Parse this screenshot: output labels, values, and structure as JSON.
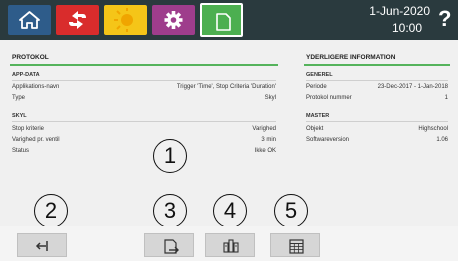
{
  "header": {
    "tabs": [
      {
        "name": "home",
        "icon": "home-icon",
        "color": "#2e5c8a"
      },
      {
        "name": "flush",
        "icon": "arrows-icon",
        "color": "#d92c2c"
      },
      {
        "name": "sun",
        "icon": "sun-icon",
        "color": "#f5c518"
      },
      {
        "name": "settings",
        "icon": "gear-icon",
        "color": "#9e3d8c"
      },
      {
        "name": "report",
        "icon": "document-icon",
        "color": "#4caf50",
        "active": true
      }
    ],
    "date": "1-Jun-2020",
    "time": "10:00",
    "help_label": "?"
  },
  "protokol": {
    "title": "PROTOKOL",
    "app_data": {
      "title": "APP-DATA",
      "rows": [
        {
          "label": "Applikations-navn",
          "value": "Trigger 'Time', Stop Criteria 'Duration'"
        },
        {
          "label": "Type",
          "value": "Skyl"
        }
      ]
    },
    "skyl": {
      "title": "SKYL",
      "rows": [
        {
          "label": "Stop kriterie",
          "value": "Varighed"
        },
        {
          "label": "Varighed pr. ventil",
          "value": "3 min"
        },
        {
          "label": "Status",
          "value": "Ikke OK"
        }
      ]
    }
  },
  "info": {
    "title": "YDERLIGERE INFORMATION",
    "generel": {
      "title": "GENEREL",
      "rows": [
        {
          "label": "Periode",
          "value": "23-Dec-2017 - 1-Jan-2018"
        },
        {
          "label": "Protokol nummer",
          "value": "1"
        }
      ]
    },
    "master": {
      "title": "MASTER",
      "rows": [
        {
          "label": "Objekt",
          "value": "Highschool"
        },
        {
          "label": "Softwareversion",
          "value": "1.06"
        }
      ]
    }
  },
  "callouts": [
    "1",
    "2",
    "3",
    "4",
    "5"
  ],
  "footer": {
    "buttons": [
      {
        "name": "back",
        "icon": "back-arrow-icon"
      },
      {
        "name": "export",
        "icon": "export-icon"
      },
      {
        "name": "compare",
        "icon": "columns-icon"
      },
      {
        "name": "table",
        "icon": "table-icon"
      }
    ]
  }
}
